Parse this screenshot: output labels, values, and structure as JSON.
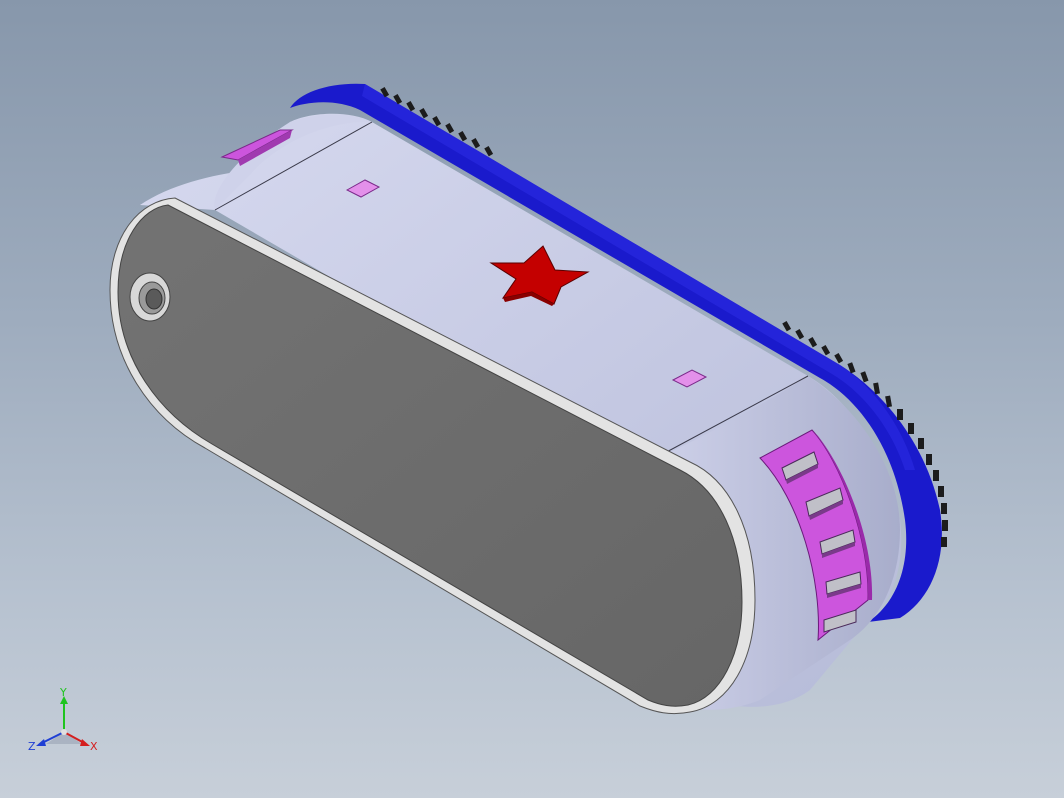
{
  "viewport": {
    "colors": {
      "background_top": "#8797ab",
      "background_bottom": "#c7cfd9",
      "body_face": "#6b6b6b",
      "body_shell": "#c4c8e2",
      "track_blue": "#1a1acc",
      "star_red": "#c40000",
      "window_pink": "#cc55dd",
      "studs": "#1c1c1c"
    },
    "model": {
      "emblem": "star-emblem"
    }
  },
  "triad": {
    "x_label": "X",
    "y_label": "Y",
    "z_label": "Z",
    "x_color": "#d41f1f",
    "y_color": "#1fc41f",
    "z_color": "#1f3fd4"
  }
}
